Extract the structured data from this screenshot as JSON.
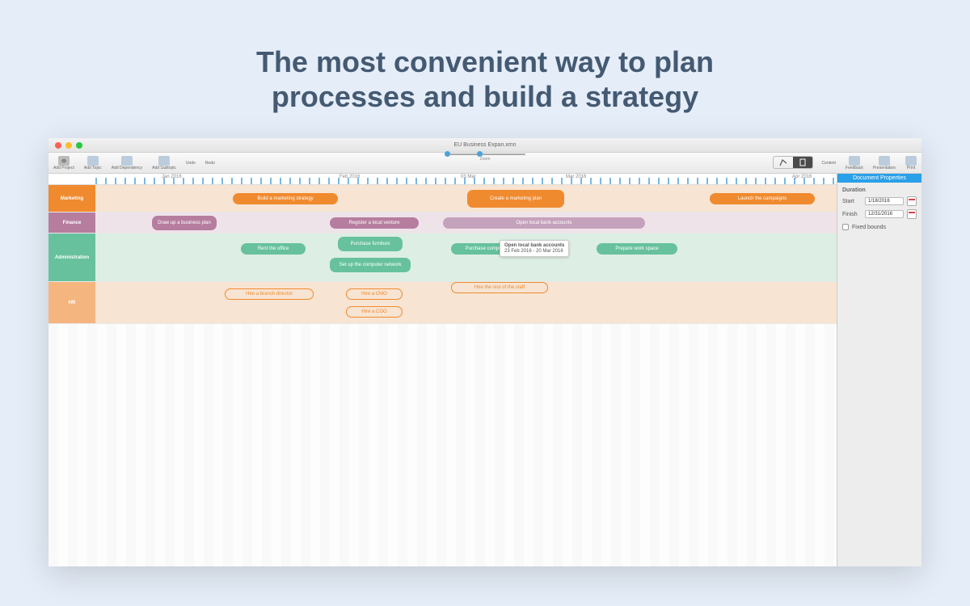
{
  "hero": {
    "title_line1": "The most convenient way to plan",
    "title_line2": "processes and build a strategy"
  },
  "window": {
    "document_title": "EU Business Expan.xmn"
  },
  "toolbar": {
    "add_project": "Add Project",
    "add_topic": "Add Topic",
    "add_dependency": "Add Dependency",
    "add_subtopic": "Add Subtopic",
    "undo": "Undo",
    "redo": "Redo",
    "zoom_label": "Zoom",
    "right": {
      "content": "Content",
      "document": "Document",
      "feedback": "Feedback",
      "presentation": "Presentation",
      "print": "Print"
    }
  },
  "timeline": {
    "months": [
      "Jan 2016",
      "Feb 2016",
      "03 Mar",
      "Mar 2016",
      "Apr 2016"
    ]
  },
  "lanes": [
    {
      "id": "marketing",
      "label": "Marketing"
    },
    {
      "id": "finance",
      "label": "Finance"
    },
    {
      "id": "admin",
      "label": "Administration"
    },
    {
      "id": "hr",
      "label": "HR"
    }
  ],
  "tasks": {
    "marketing_build_strategy": "Build a marketing strategy",
    "marketing_create_plan": "Create a marketing plan",
    "marketing_launch": "Launch the campaigns",
    "finance_draw_plan": "Draw up a business plan",
    "finance_register": "Register a local venture",
    "finance_open_accounts": "Open local bank accounts",
    "admin_rent": "Rent the office",
    "admin_purchase_furniture": "Purchase furniture",
    "admin_setup_network": "Set up the computer network",
    "admin_purchase_computers": "Purchase computers",
    "admin_prepare": "Prepare work space",
    "hr_branch_director": "Hire a branch director",
    "hr_cmo": "Hire a CMO",
    "hr_coo": "Hire a COO",
    "hr_rest": "Hire the rest of the staff"
  },
  "tooltip": {
    "title": "Open local bank accounts",
    "dates": "23 Feb 2016 - 20 Mar 2016"
  },
  "panel": {
    "header": "Document Properties",
    "section": "Duration",
    "start_label": "Start",
    "start_value": "1/18/2016",
    "finish_label": "Finish",
    "finish_value": "12/31/2016",
    "fixed_bounds": "Fixed bounds"
  }
}
